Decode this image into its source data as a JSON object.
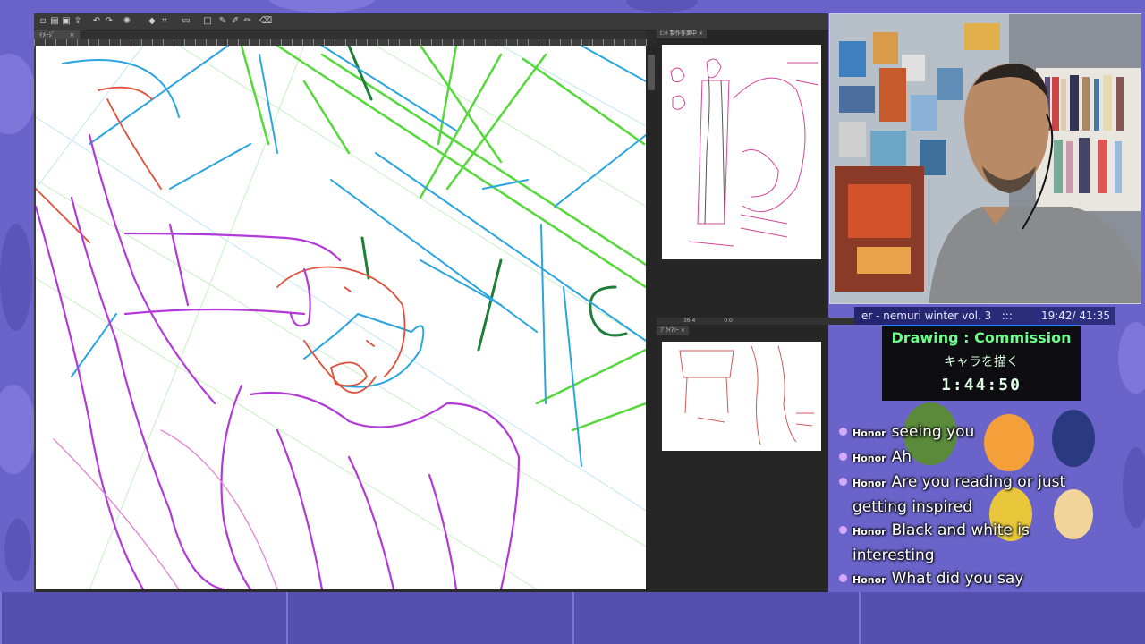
{
  "app": {
    "canvas_tab_label": "ｲﾒｰｼﾞ",
    "ref_tab_label": "ﾋﾝﾄ 製作作業中",
    "preview_tab_label": "ﾌﾟﾗｲﾏﾘｰ",
    "zoom_readout": "36.4",
    "angle_readout": "0.0"
  },
  "stream": {
    "song": "er - nemuri winter vol. 3",
    "separator": ":::",
    "time": "19:42/ 41:35",
    "activity": "Drawing : Commission",
    "activity_jp": "キャラを描く",
    "timer": "1:44:50"
  },
  "chat": [
    {
      "user": "Honor",
      "text": "seeing you"
    },
    {
      "user": "Honor",
      "text": "Ah"
    },
    {
      "user": "Honor",
      "text": "Are you reading or just getting inspired"
    },
    {
      "user": "Honor",
      "text": "Black and white is interesting"
    },
    {
      "user": "Honor",
      "text": "What did you say"
    }
  ],
  "colors": {
    "background": "#6a63c9",
    "timer_green": "#6dfc89",
    "sketch_magenta": "#b23ad8",
    "sketch_blue": "#2aa5e0",
    "sketch_green": "#55d93a",
    "sketch_red": "#e0503a"
  }
}
